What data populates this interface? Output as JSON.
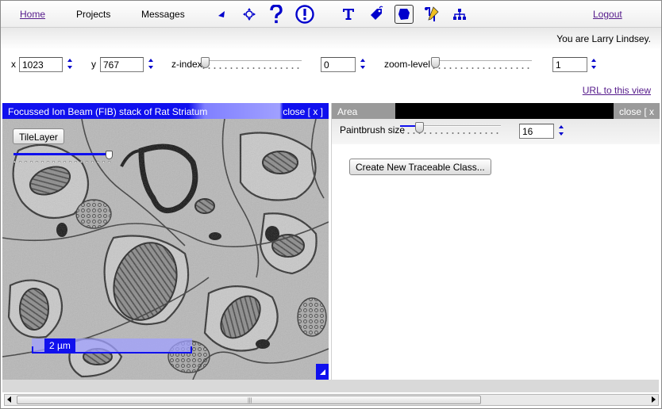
{
  "nav": {
    "home": "Home",
    "projects": "Projects",
    "messages": "Messages",
    "logout": "Logout"
  },
  "toolbar": {
    "tools": [
      {
        "icon": "navigate-arrow-icon"
      },
      {
        "icon": "move-crosshair-icon"
      },
      {
        "icon": "help-question-icon"
      },
      {
        "icon": "alert-exclamation-icon"
      },
      {
        "icon": "text-tool-icon"
      },
      {
        "icon": "tag-tool-icon"
      },
      {
        "icon": "area-segment-tool-icon",
        "active": true
      },
      {
        "icon": "tracing-tool-icon"
      },
      {
        "icon": "hierarchy-tree-icon"
      }
    ]
  },
  "user": {
    "text": "You are Larry Lindsey."
  },
  "coords": {
    "x_label": "x",
    "x_value": "1023",
    "y_label": "y",
    "y_value": "767",
    "z_label": "z-index",
    "z_value": "0",
    "z_level": 0,
    "zoom_label": "zoom-level",
    "zoom_value": "1",
    "zoom_level": 0
  },
  "url_link": "URL to this view",
  "stack": {
    "title": "Focussed Ion Beam (FIB) stack of Rat Striatum",
    "close": "close [ x ]",
    "tilelayer": "TileLayer",
    "opacity": 1,
    "scale_text": "2 µm"
  },
  "panel": {
    "tab": "Area Segment",
    "close": "close [ x ]",
    "brush_label": "Paintbrush size",
    "brush_value": "16",
    "brush_level": 0.16,
    "create_button": "Create New Traceable Class..."
  },
  "colors": {
    "title_blue": "#1010ee",
    "link_purple": "#551a8b",
    "panel_grey": "#9a9a9a"
  }
}
